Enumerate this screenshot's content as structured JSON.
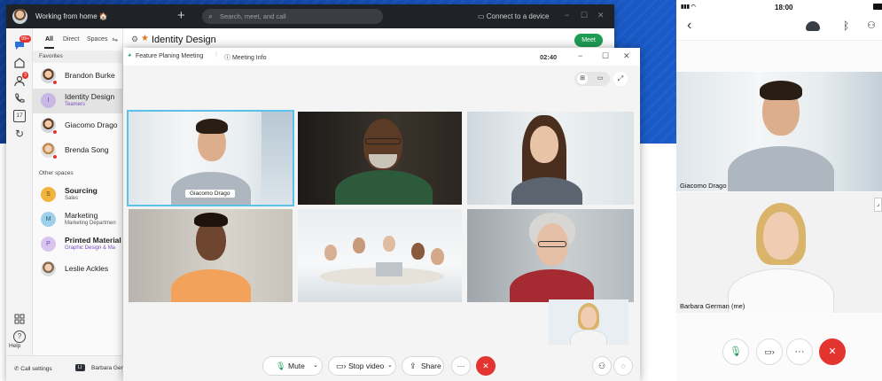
{
  "desktop": {
    "titlebar": {
      "status": "Working from home 🏠",
      "search_placeholder": "Search, meet, and call",
      "connect_label": "Connect to a device",
      "minimize": "−",
      "maximize": "☐",
      "close": "✕"
    },
    "rail": {
      "badge": "99+",
      "contacts_badge": "3",
      "calendar_day": "17",
      "help_label": "Help"
    },
    "panel": {
      "tabs": [
        "All",
        "Direct",
        "Spaces"
      ],
      "favorites_header": "Favorites",
      "other_header": "Other spaces",
      "favorites": [
        {
          "name": "Brandon Burke",
          "sub": ""
        },
        {
          "name": "Identity Design",
          "sub": "Teamers",
          "initial": "I"
        },
        {
          "name": "Giacomo Drago",
          "sub": ""
        },
        {
          "name": "Brenda Song",
          "sub": ""
        }
      ],
      "others": [
        {
          "name": "Sourcing",
          "sub": "Sales",
          "initial": "S"
        },
        {
          "name": "Marketing",
          "sub": "Marketing Departmen",
          "initial": "M"
        },
        {
          "name": "Printed Material",
          "sub": "Graphic Design & Ma",
          "initial": "P"
        },
        {
          "name": "Leslie Ackles",
          "sub": ""
        }
      ]
    },
    "footer": {
      "call_settings": "Call settings",
      "device_tag": "LI",
      "device_user": "Barbara Ger"
    },
    "space": {
      "title": "Identity Design",
      "meet_label": "Meet"
    }
  },
  "meeting": {
    "title": "Feature Planing Meeting",
    "info_label": "Meeting Info",
    "timer": "02:40",
    "active_speaker": "Giacomo Drago",
    "controls": {
      "mute": "Mute",
      "stop_video": "Stop video",
      "share": "Share",
      "more": "···",
      "end": "✕"
    }
  },
  "mobile": {
    "time": "18:00",
    "participants": [
      {
        "name": "Giacomo Drago"
      },
      {
        "name": "Barbara German (me)"
      }
    ],
    "more": "···",
    "end": "✕"
  },
  "colors": {
    "accent_green": "#1e9b54",
    "end_red": "#e3342f",
    "active_outline": "#5cc0ea",
    "brand_blue": "#1650b8"
  }
}
